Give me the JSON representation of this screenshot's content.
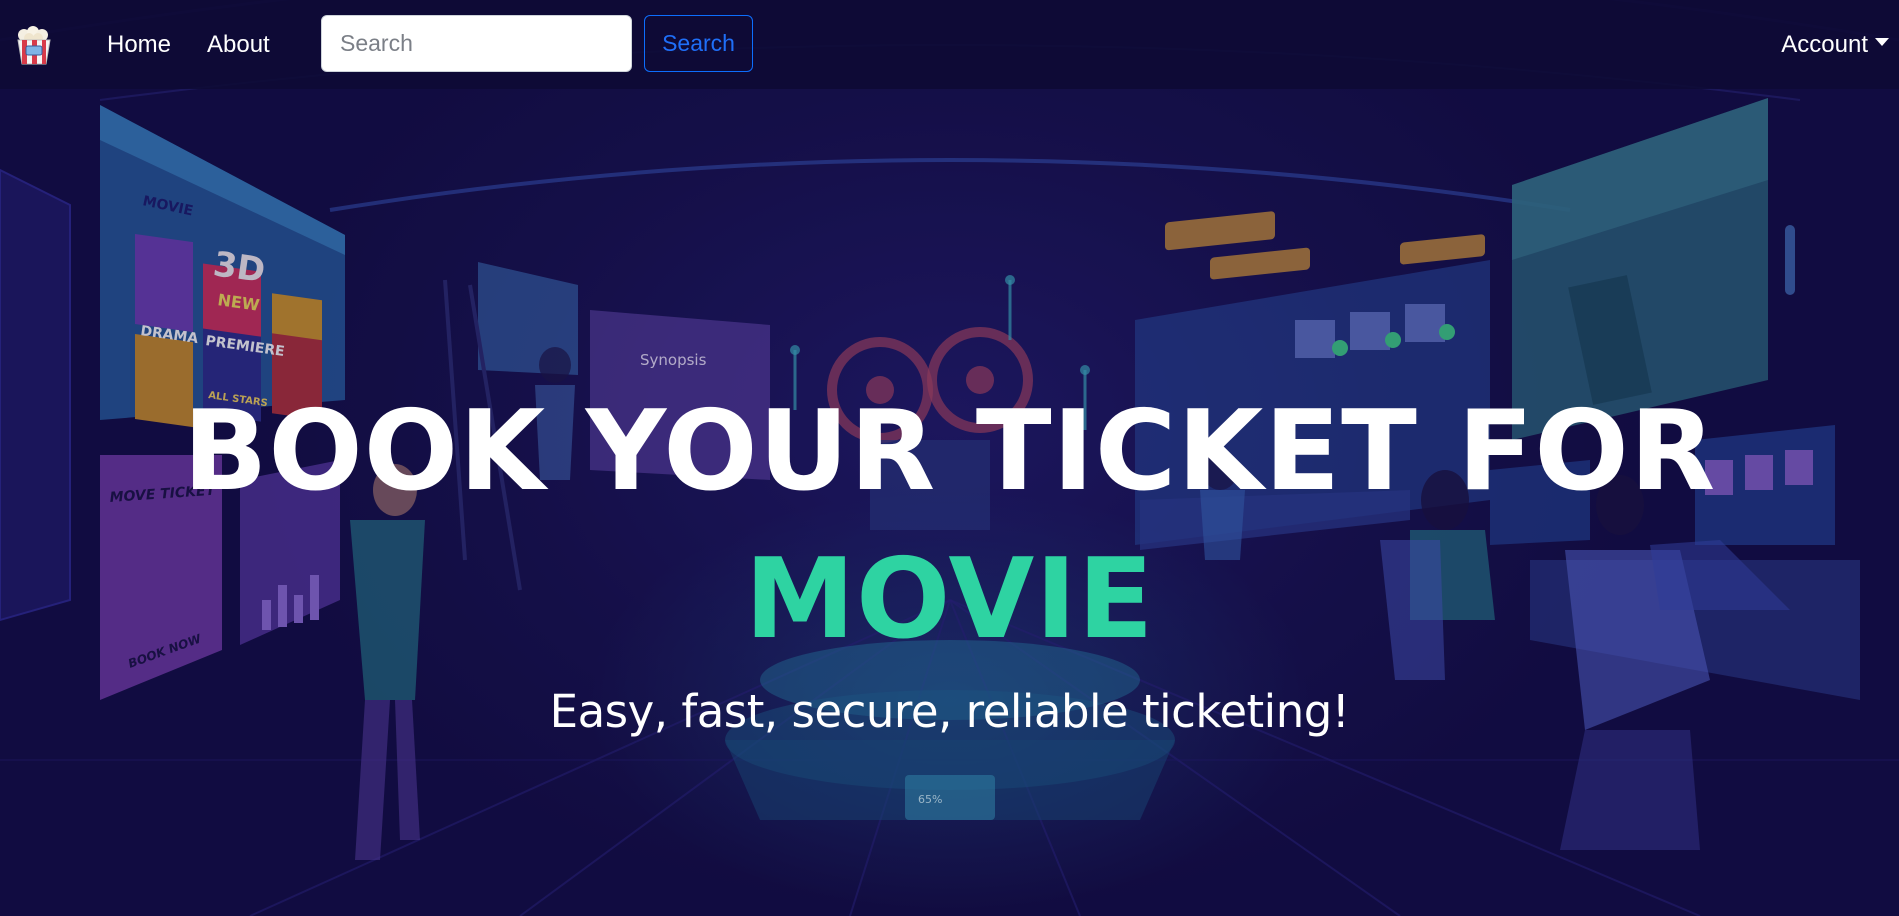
{
  "nav": {
    "brand_icon": "popcorn-icon",
    "home_label": "Home",
    "about_label": "About",
    "search_placeholder": "Search",
    "search_value": "",
    "search_button_label": "Search",
    "account_label": "Account"
  },
  "hero": {
    "headline_line1": "BOOK YOUR TICKET FOR",
    "headline_line2": "MOVIE",
    "tagline": "Easy, fast, secure, reliable ticketing!",
    "illustration": {
      "poster_left_top": "MOVIE",
      "poster_3d": "3D",
      "poster_new": "NEW",
      "poster_drama": "DRAMA",
      "poster_premiere": "PREMIERE",
      "poster_allstars": "ALL STARS",
      "ticket_title": "MOVE TICKET",
      "ticket_cta": "BOOK NOW",
      "synopsis_label": "Synopsis",
      "progress_label": "65%"
    }
  },
  "colors": {
    "background": "#15104a",
    "navbar": "#0e0a34",
    "accent_green": "#2ed3a2",
    "search_button_border": "#0d6efd"
  }
}
